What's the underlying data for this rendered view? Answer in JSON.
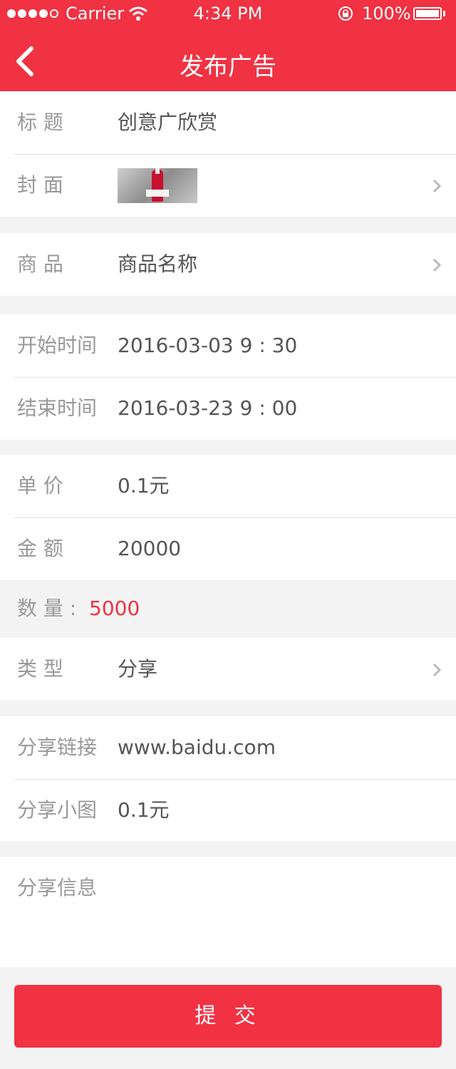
{
  "status_bar": {
    "carrier": "Carrier",
    "time": "4:34 PM",
    "battery": "100%"
  },
  "nav": {
    "title": "发布广告"
  },
  "fields": {
    "title": {
      "label": "标 题",
      "value": "创意广欣赏"
    },
    "cover": {
      "label": "封 面"
    },
    "product": {
      "label": "商 品",
      "value": "商品名称"
    },
    "start_time": {
      "label": "开始时间",
      "value": "2016-03-03  9 : 30"
    },
    "end_time": {
      "label": "结束时间",
      "value": "2016-03-23  9 : 00"
    },
    "unit_price": {
      "label": "单 价",
      "value": "0.1元"
    },
    "amount": {
      "label": "金 额",
      "value": "20000"
    },
    "quantity": {
      "label": "数 量 :",
      "value": "5000"
    },
    "type": {
      "label": "类 型",
      "value": "分享"
    },
    "share_link": {
      "label": "分享链接",
      "value": "www.baidu.com"
    },
    "share_thumb": {
      "label": "分享小图",
      "value": "0.1元"
    },
    "share_info": {
      "label": "分享信息"
    }
  },
  "submit_label": "提 交",
  "colors": {
    "accent": "#f03243",
    "background": "#f3f3f3",
    "label": "#999999",
    "value": "#555555"
  }
}
